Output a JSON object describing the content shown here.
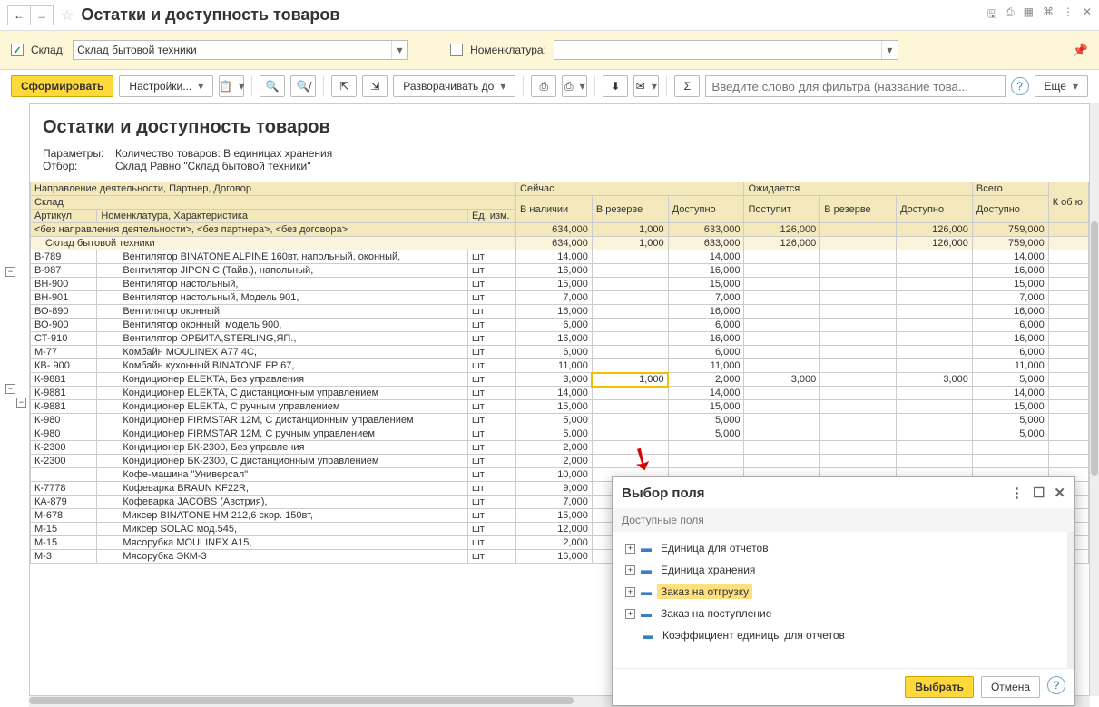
{
  "title": "Остатки и доступность товаров",
  "filter": {
    "sklad_label": "Склад:",
    "sklad_value": "Склад бытовой техники",
    "sklad_checked": true,
    "nomen_label": "Номенклатура:",
    "nomen_value": "",
    "nomen_checked": false
  },
  "toolbar": {
    "form": "Сформировать",
    "settings": "Настройки...",
    "expand": "Разворачивать до",
    "more": "Еще",
    "filter_placeholder": "Введите слово для фильтра (название това..."
  },
  "report": {
    "title": "Остатки и доступность товаров",
    "param_label": "Параметры:",
    "param_value": "Количество товаров: В единицах хранения",
    "filter_label": "Отбор:",
    "filter_value": "Склад Равно \"Склад бытовой техники\""
  },
  "headers": {
    "dir": "Направление деятельности, Партнер, Договор",
    "sklad": "Склад",
    "art": "Артикул",
    "nomen": "Номенклатура, Характеристика",
    "ed": "Ед. изм.",
    "now": "Сейчас",
    "expect": "Ожидается",
    "total": "Всего",
    "avail": "В наличии",
    "reserve": "В резерве",
    "access": "Доступно",
    "arrive": "Поступит",
    "k": "К об ю"
  },
  "group0_label": "<без направления деятельности>, <без партнера>, <без договора>",
  "group1_label": "Склад бытовой техники",
  "group0": [
    "634,000",
    "1,000",
    "633,000",
    "126,000",
    "",
    "126,000",
    "759,000"
  ],
  "group1": [
    "634,000",
    "1,000",
    "633,000",
    "126,000",
    "",
    "126,000",
    "759,000"
  ],
  "rows": [
    {
      "art": "В-789",
      "name": "Вентилятор BINATONE ALPINE 160вт, напольный, оконный,",
      "u": "шт",
      "v": [
        "14,000",
        "",
        "14,000",
        "",
        "",
        "",
        "14,000"
      ]
    },
    {
      "art": "В-987",
      "name": "Вентилятор JIPONIC (Тайв.), напольный,",
      "u": "шт",
      "v": [
        "16,000",
        "",
        "16,000",
        "",
        "",
        "",
        "16,000"
      ]
    },
    {
      "art": "ВН-900",
      "name": "Вентилятор настольный,",
      "u": "шт",
      "v": [
        "15,000",
        "",
        "15,000",
        "",
        "",
        "",
        "15,000"
      ]
    },
    {
      "art": "ВН-901",
      "name": "Вентилятор настольный, Модель 901,",
      "u": "шт",
      "v": [
        "7,000",
        "",
        "7,000",
        "",
        "",
        "",
        "7,000"
      ]
    },
    {
      "art": "ВО-890",
      "name": "Вентилятор оконный,",
      "u": "шт",
      "v": [
        "16,000",
        "",
        "16,000",
        "",
        "",
        "",
        "16,000"
      ]
    },
    {
      "art": "ВО-900",
      "name": "Вентилятор оконный, модель 900,",
      "u": "шт",
      "v": [
        "6,000",
        "",
        "6,000",
        "",
        "",
        "",
        "6,000"
      ]
    },
    {
      "art": "СТ-910",
      "name": "Вентилятор ОРБИТА,STERLING,ЯП.,",
      "u": "шт",
      "v": [
        "16,000",
        "",
        "16,000",
        "",
        "",
        "",
        "16,000"
      ]
    },
    {
      "art": "М-77",
      "name": "Комбайн MOULINEX  А77 4С,",
      "u": "шт",
      "v": [
        "6,000",
        "",
        "6,000",
        "",
        "",
        "",
        "6,000"
      ]
    },
    {
      "art": "КВ- 900",
      "name": "Комбайн кухонный BINATONE FP 67,",
      "u": "шт",
      "v": [
        "11,000",
        "",
        "11,000",
        "",
        "",
        "",
        "11,000"
      ]
    },
    {
      "art": "К-9881",
      "name": "Кондиционер ELEKTA, Без управления",
      "u": "шт",
      "v": [
        "3,000",
        "1,000",
        "2,000",
        "3,000",
        "",
        "3,000",
        "5,000"
      ],
      "hl": 1
    },
    {
      "art": "К-9881",
      "name": "Кондиционер ELEKTA, С дистанционным управлением",
      "u": "шт",
      "v": [
        "14,000",
        "",
        "14,000",
        "",
        "",
        "",
        "14,000"
      ]
    },
    {
      "art": "К-9881",
      "name": "Кондиционер ELEKTA, С ручным управлением",
      "u": "шт",
      "v": [
        "15,000",
        "",
        "15,000",
        "",
        "",
        "",
        "15,000"
      ]
    },
    {
      "art": "К-980",
      "name": "Кондиционер FIRMSTAR 12M, С дистанционным управлением",
      "u": "шт",
      "v": [
        "5,000",
        "",
        "5,000",
        "",
        "",
        "",
        "5,000"
      ]
    },
    {
      "art": "К-980",
      "name": "Кондиционер FIRMSTAR 12M, С ручным управлением",
      "u": "шт",
      "v": [
        "5,000",
        "",
        "5,000",
        "",
        "",
        "",
        "5,000"
      ]
    },
    {
      "art": "К-2300",
      "name": "Кондиционер БК-2300, Без управления",
      "u": "шт",
      "v": [
        "2,000",
        "",
        "",
        "",
        "",
        "",
        ""
      ]
    },
    {
      "art": "К-2300",
      "name": "Кондиционер БК-2300, С дистанционным управлением",
      "u": "шт",
      "v": [
        "2,000",
        "",
        "",
        "",
        "",
        "",
        ""
      ]
    },
    {
      "art": "",
      "name": "Кофе-машина \"Универсал\"",
      "u": "шт",
      "v": [
        "10,000",
        "",
        "",
        "",
        "",
        "",
        ""
      ]
    },
    {
      "art": "К-7778",
      "name": "Кофеварка BRAUN KF22R,",
      "u": "шт",
      "v": [
        "9,000",
        "",
        "",
        "",
        "",
        "",
        ""
      ]
    },
    {
      "art": "КА-879",
      "name": "Кофеварка JACOBS (Австрия),",
      "u": "шт",
      "v": [
        "7,000",
        "",
        "",
        "",
        "",
        "",
        ""
      ]
    },
    {
      "art": "М-678",
      "name": "Миксер BINATONE HM 212,6 скор. 150вт,",
      "u": "шт",
      "v": [
        "15,000",
        "",
        "",
        "",
        "",
        "",
        ""
      ]
    },
    {
      "art": "М-15",
      "name": "Миксер SOLAC мод.545,",
      "u": "шт",
      "v": [
        "12,000",
        "",
        "",
        "",
        "",
        "",
        ""
      ]
    },
    {
      "art": "М-15",
      "name": "Мясорубка MOULINEX  А15,",
      "u": "шт",
      "v": [
        "2,000",
        "",
        "",
        "",
        "",
        "",
        ""
      ]
    },
    {
      "art": "М-3",
      "name": "Мясорубка ЭКМ-3",
      "u": "шт",
      "v": [
        "16,000",
        "",
        "",
        "",
        "",
        "",
        ""
      ]
    }
  ],
  "dialog": {
    "title": "Выбор поля",
    "subtitle": "Доступные поля",
    "items": [
      {
        "label": "Единица для отчетов",
        "exp": true
      },
      {
        "label": "Единица хранения",
        "exp": true
      },
      {
        "label": "Заказ на отгрузку",
        "exp": true,
        "sel": true
      },
      {
        "label": "Заказ на поступление",
        "exp": true
      },
      {
        "label": "Коэффициент единицы для отчетов",
        "exp": false
      }
    ],
    "select": "Выбрать",
    "cancel": "Отмена"
  }
}
